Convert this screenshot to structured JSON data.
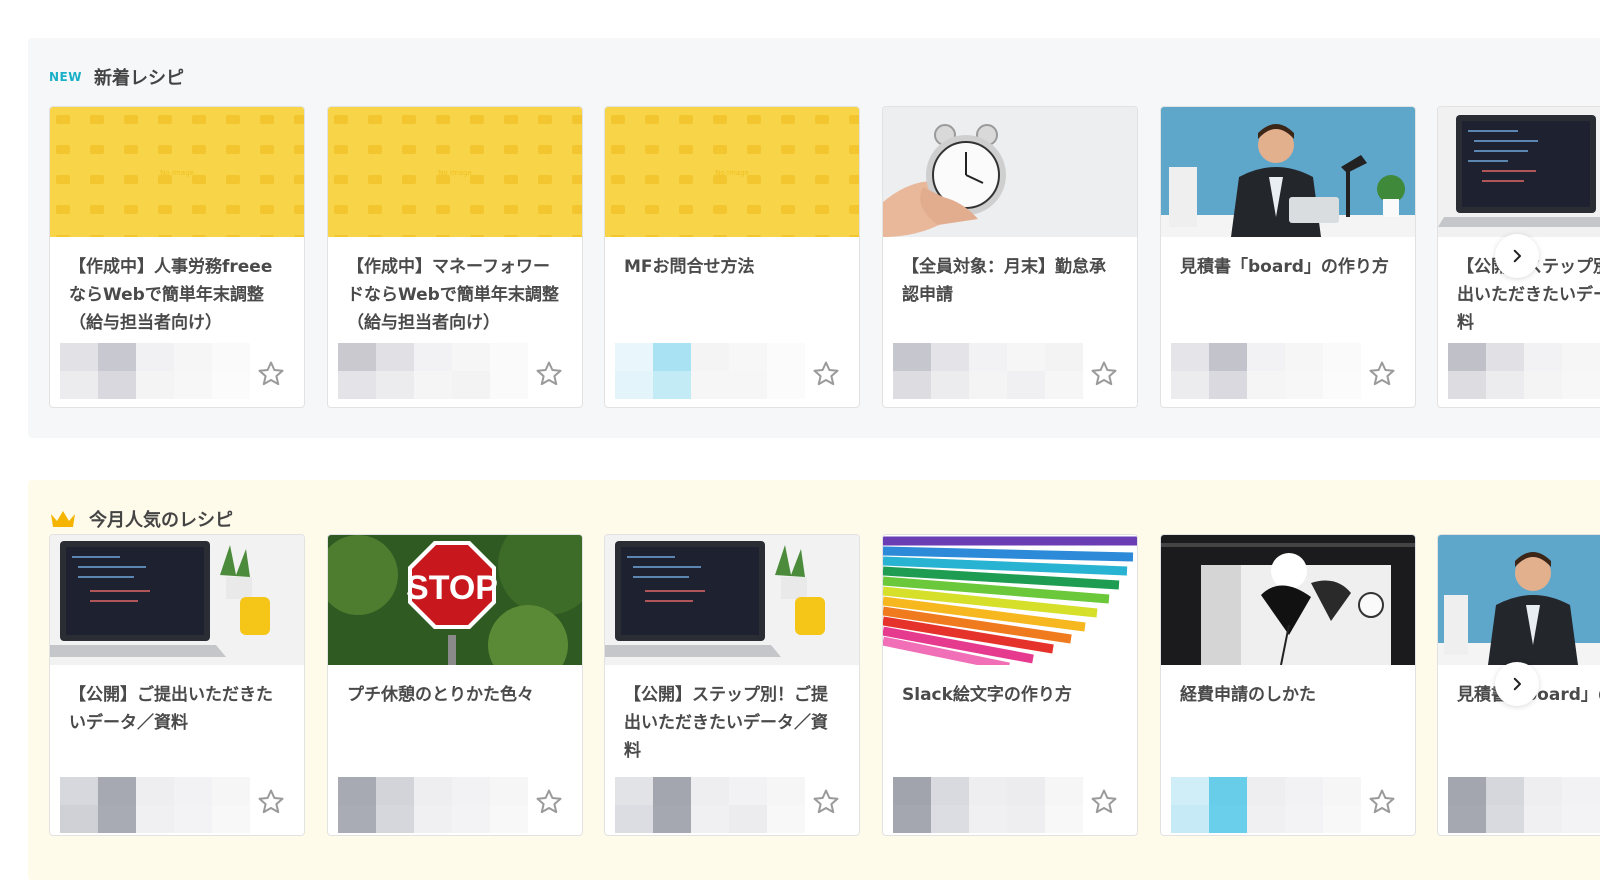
{
  "sections": {
    "new": {
      "badge": "NEW",
      "title": "新着レシピ",
      "cards": [
        {
          "title": "【作成中】人事労務freeeならWebで簡単年末調整（給与担当者向け）",
          "image": "no-image",
          "noimage_text": "No Image"
        },
        {
          "title": "【作成中】マネーフォワードならWebで簡単年末調整（給与担当者向け）",
          "image": "no-image",
          "noimage_text": "No Image"
        },
        {
          "title": "MFお問合せ方法",
          "image": "no-image",
          "noimage_text": "No Image"
        },
        {
          "title": "【全員対象：月末】勤怠承認申請",
          "image": "clock-photo"
        },
        {
          "title": "見積書「board」の作り方",
          "image": "businessman-photo"
        },
        {
          "title": "【公開】ステップ別！ご提出いただきたいデータ／資料",
          "image": "laptop-photo"
        }
      ]
    },
    "popular": {
      "title": "今月人気のレシピ",
      "cards": [
        {
          "title": "【公開】ご提出いただきたいデータ／資料",
          "image": "laptop-photo"
        },
        {
          "title": "プチ休憩のとりかた色々",
          "image": "stop-sign-photo",
          "image_text": "STOP"
        },
        {
          "title": "【公開】ステップ別！ご提出いただきたいデータ／資料",
          "image": "laptop-photo"
        },
        {
          "title": "Slack絵文字の作り方",
          "image": "color-pencils-photo"
        },
        {
          "title": "経費申請のしかた",
          "image": "photo-studio-photo"
        },
        {
          "title": "見積書「board」の作り方",
          "image": "businessman-photo"
        }
      ]
    }
  },
  "icons": {
    "star": "star-outline-icon",
    "next": "chevron-right-icon",
    "crown": "crown-icon"
  },
  "colors": {
    "new_badge": "#19b0c8",
    "noimage_bg": "#f8d548",
    "crown": "#f4b400",
    "popular_bg": "#fffbea",
    "new_bg": "#f6f7f8"
  }
}
